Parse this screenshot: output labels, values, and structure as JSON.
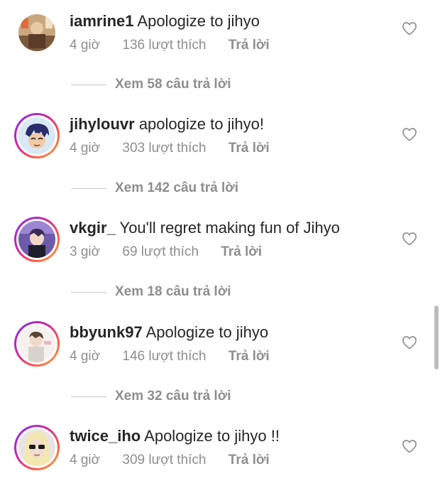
{
  "comments": [
    {
      "username": "iamrine1",
      "text": "Apologize to jihyo",
      "time": "4 giờ",
      "likes": "136 lượt thích",
      "reply": "Trả lời",
      "view_replies": "Xem 58 câu trả lời",
      "has_story_ring": false
    },
    {
      "username": "jihylouvr",
      "text": "apologize to jihyo!",
      "time": "4 giờ",
      "likes": "303 lượt thích",
      "reply": "Trả lời",
      "view_replies": "Xem 142 câu trả lời",
      "has_story_ring": true
    },
    {
      "username": "vkgir_",
      "text": "You'll regret making fun of Jihyo",
      "time": "3 giờ",
      "likes": "69 lượt thích",
      "reply": "Trả lời",
      "view_replies": "Xem 18 câu trả lời",
      "has_story_ring": true
    },
    {
      "username": "bbyunk97",
      "text": "Apologize to jihyo",
      "time": "4 giờ",
      "likes": "146 lượt thích",
      "reply": "Trả lời",
      "view_replies": "Xem 32 câu trả lời",
      "has_story_ring": true
    },
    {
      "username": "twice_iho",
      "text": "Apologize to jihyo !!",
      "time": "4 giờ",
      "likes": "309 lượt thích",
      "reply": "Trả lời",
      "has_story_ring": true
    }
  ],
  "colors": {
    "text": "#262626",
    "meta": "#8e8e8e",
    "divider": "#c7c7c7",
    "ring_start": "#7b2ff7",
    "ring_end": "#fdb03b"
  }
}
